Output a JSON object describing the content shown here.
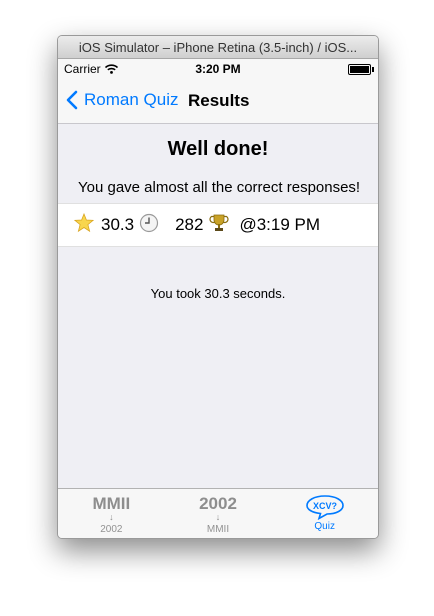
{
  "window": {
    "title": "iOS Simulator – iPhone Retina (3.5-inch) / iOS..."
  },
  "status": {
    "carrier": "Carrier",
    "time": "3:20 PM"
  },
  "nav": {
    "back_label": "Roman Quiz",
    "title": "Results"
  },
  "results": {
    "heading": "Well done!",
    "message": "You gave almost all the correct responses!",
    "stats": {
      "time_value": "30.3",
      "score_value": "282",
      "timestamp": "@3:19 PM"
    },
    "summary": "You took 30.3 seconds."
  },
  "tabs": [
    {
      "big": "MMII",
      "label": "2002"
    },
    {
      "big": "2002",
      "label": "MMII"
    },
    {
      "icon_text": "XCV?",
      "label": "Quiz"
    }
  ],
  "colors": {
    "accent": "#007aff",
    "background": "#efeff4"
  },
  "icons": [
    "wifi-icon",
    "battery-icon",
    "back-chevron-icon",
    "star-icon",
    "clock-icon",
    "trophy-icon",
    "down-arrow-icon",
    "speech-bubble-icon"
  ]
}
